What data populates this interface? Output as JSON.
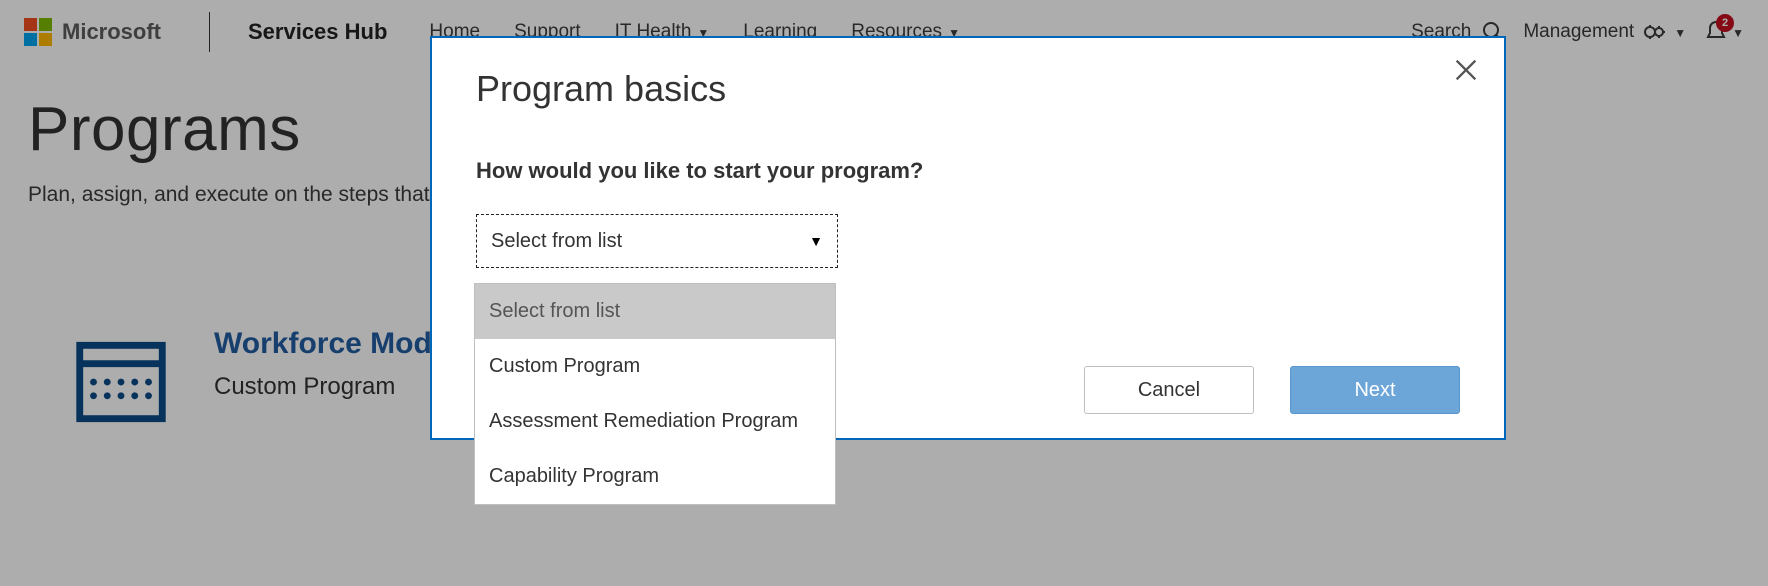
{
  "header": {
    "microsoft": "Microsoft",
    "hub": "Services Hub",
    "nav": {
      "home": "Home",
      "support": "Support",
      "it_health": "IT Health",
      "learning": "Learning",
      "resources": "Resources"
    },
    "search": "Search",
    "management": "Management",
    "notification_count": "2"
  },
  "page": {
    "title": "Programs",
    "subtitle": "Plan, assign, and execute on the steps that v",
    "card": {
      "title": "Workforce Mod                                              t Teams",
      "subtitle": "Custom Program"
    }
  },
  "modal": {
    "title": "Program basics",
    "question": "How would you like to start your program?",
    "select_placeholder": "Select from list",
    "cancel": "Cancel",
    "next": "Next"
  },
  "dropdown": {
    "placeholder": "Select from list",
    "options": [
      "Custom Program",
      "Assessment Remediation Program",
      "Capability Program"
    ]
  }
}
